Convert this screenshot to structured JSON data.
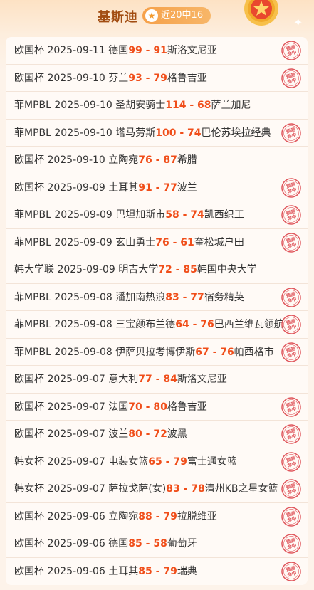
{
  "header": {
    "title": "基斯迪",
    "badge_icon": "star-icon",
    "badge_text": "近20中16"
  },
  "stamp_label_top": "预测",
  "stamp_label_bottom": "命中",
  "score_separator": " - ",
  "rows": [
    {
      "league": "欧国杯",
      "date": "2025-09-11",
      "home": "德国",
      "home_score": "99",
      "away_score": "91",
      "away": "斯洛文尼亚",
      "hit": true
    },
    {
      "league": "欧国杯",
      "date": "2025-09-10",
      "home": "芬兰",
      "home_score": "93",
      "away_score": "79",
      "away": "格鲁吉亚",
      "hit": true
    },
    {
      "league": "菲MPBL",
      "date": "2025-09-10",
      "home": "圣胡安骑士",
      "home_score": "114",
      "away_score": "68",
      "away": "萨兰加尼",
      "hit": false
    },
    {
      "league": "菲MPBL",
      "date": "2025-09-10",
      "home": "塔马劳斯",
      "home_score": "100",
      "away_score": "74",
      "away": "巴伦苏埃拉经典",
      "hit": true
    },
    {
      "league": "欧国杯",
      "date": "2025-09-10",
      "home": "立陶宛",
      "home_score": "76",
      "away_score": "87",
      "away": "希腊",
      "hit": false
    },
    {
      "league": "欧国杯",
      "date": "2025-09-09",
      "home": "土耳其",
      "home_score": "91",
      "away_score": "77",
      "away": "波兰",
      "hit": true
    },
    {
      "league": "菲MPBL",
      "date": "2025-09-09",
      "home": "巴坦加斯市",
      "home_score": "58",
      "away_score": "74",
      "away": "凯西织工",
      "hit": true
    },
    {
      "league": "菲MPBL",
      "date": "2025-09-09",
      "home": "玄山勇士",
      "home_score": "76",
      "away_score": "61",
      "away": "奎松城户田",
      "hit": true
    },
    {
      "league": "韩大学联",
      "date": "2025-09-09",
      "home": "明吉大学",
      "home_score": "72",
      "away_score": "85",
      "away": "韩国中央大学",
      "hit": false
    },
    {
      "league": "菲MPBL",
      "date": "2025-09-08",
      "home": "潘加南热浪",
      "home_score": "83",
      "away_score": "77",
      "away": "宿务精英",
      "hit": true
    },
    {
      "league": "菲MPBL",
      "date": "2025-09-08",
      "home": "三宝颜布兰德",
      "home_score": "64",
      "away_score": "76",
      "away": "巴西兰维瓦领航",
      "hit": true
    },
    {
      "league": "菲MPBL",
      "date": "2025-09-08",
      "home": "伊萨贝拉考博伊斯",
      "home_score": "67",
      "away_score": "76",
      "away": "帕西格市",
      "hit": true
    },
    {
      "league": "欧国杯",
      "date": "2025-09-07",
      "home": "意大利",
      "home_score": "77",
      "away_score": "84",
      "away": "斯洛文尼亚",
      "hit": false
    },
    {
      "league": "欧国杯",
      "date": "2025-09-07",
      "home": "法国",
      "home_score": "70",
      "away_score": "80",
      "away": "格鲁吉亚",
      "hit": true
    },
    {
      "league": "欧国杯",
      "date": "2025-09-07",
      "home": "波兰",
      "home_score": "80",
      "away_score": "72",
      "away": "波黑",
      "hit": true
    },
    {
      "league": "韩女杯",
      "date": "2025-09-07",
      "home": "电装女篮",
      "home_score": "65",
      "away_score": "79",
      "away": "富士通女篮",
      "hit": true
    },
    {
      "league": "韩女杯",
      "date": "2025-09-07",
      "home": "萨拉戈萨(女)",
      "home_score": "83",
      "away_score": "78",
      "away": "清州KB之星女篮",
      "hit": true
    },
    {
      "league": "欧国杯",
      "date": "2025-09-06",
      "home": "立陶宛",
      "home_score": "88",
      "away_score": "79",
      "away": "拉脱维亚",
      "hit": true
    },
    {
      "league": "欧国杯",
      "date": "2025-09-06",
      "home": "德国",
      "home_score": "85",
      "away_score": "58",
      "away": "葡萄牙",
      "hit": true
    },
    {
      "league": "欧国杯",
      "date": "2025-09-06",
      "home": "土耳其",
      "home_score": "85",
      "away_score": "79",
      "away": "瑞典",
      "hit": true
    }
  ]
}
